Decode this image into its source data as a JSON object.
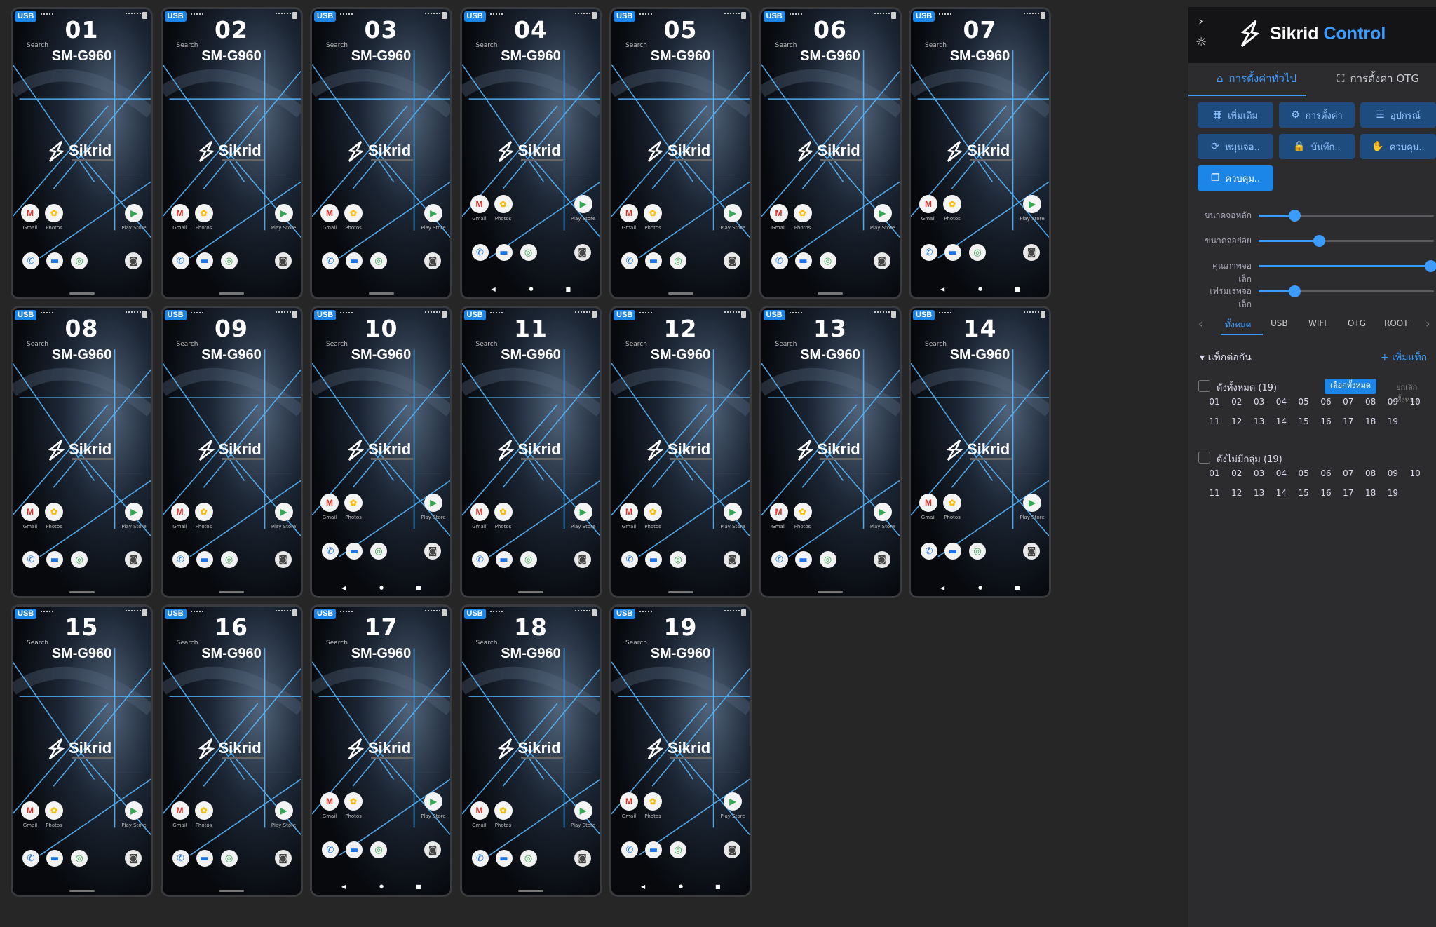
{
  "phones": [
    {
      "num": "01",
      "model": "SM-G960",
      "usb": "USB",
      "search": "Search",
      "navbar": false
    },
    {
      "num": "02",
      "model": "SM-G960",
      "usb": "USB",
      "search": "Search",
      "navbar": false
    },
    {
      "num": "03",
      "model": "SM-G960",
      "usb": "USB",
      "search": "Search",
      "navbar": false
    },
    {
      "num": "04",
      "model": "SM-G960",
      "usb": "USB",
      "search": "Search",
      "navbar": true
    },
    {
      "num": "05",
      "model": "SM-G960",
      "usb": "USB",
      "search": "Search",
      "navbar": false
    },
    {
      "num": "06",
      "model": "SM-G960",
      "usb": "USB",
      "search": "Search",
      "navbar": false
    },
    {
      "num": "07",
      "model": "SM-G960",
      "usb": "USB",
      "search": "Search",
      "navbar": true
    },
    {
      "num": "08",
      "model": "SM-G960",
      "usb": "USB",
      "search": "Search",
      "navbar": false
    },
    {
      "num": "09",
      "model": "SM-G960",
      "usb": "USB",
      "search": "Search",
      "navbar": false
    },
    {
      "num": "10",
      "model": "SM-G960",
      "usb": "USB",
      "search": "Search",
      "navbar": true
    },
    {
      "num": "11",
      "model": "SM-G960",
      "usb": "USB",
      "search": "Search",
      "navbar": false
    },
    {
      "num": "12",
      "model": "SM-G960",
      "usb": "USB",
      "search": "Search",
      "navbar": false
    },
    {
      "num": "13",
      "model": "SM-G960",
      "usb": "USB",
      "search": "Search",
      "navbar": false
    },
    {
      "num": "14",
      "model": "SM-G960",
      "usb": "USB",
      "search": "Search",
      "navbar": true
    },
    {
      "num": "15",
      "model": "SM-G960",
      "usb": "USB",
      "search": "Search",
      "navbar": false
    },
    {
      "num": "16",
      "model": "SM-G960",
      "usb": "USB",
      "search": "Search",
      "navbar": false
    },
    {
      "num": "17",
      "model": "SM-G960",
      "usb": "USB",
      "search": "Search",
      "navbar": true
    },
    {
      "num": "18",
      "model": "SM-G960",
      "usb": "USB",
      "search": "Search",
      "navbar": false
    },
    {
      "num": "19",
      "model": "SM-G960",
      "usb": "USB",
      "search": "Search",
      "navbar": true
    }
  ],
  "phone_screen": {
    "logo_text": "Sikrid",
    "apps": [
      {
        "icon": "gmail-icon",
        "glyph": "M",
        "label": "Gmail",
        "color": "#d93025"
      },
      {
        "icon": "photos-icon",
        "glyph": "✿",
        "label": "Photos",
        "color": "#fbbc04"
      },
      {
        "icon": "play-store-icon",
        "glyph": "▶",
        "label": "Play Store",
        "color": "#34a853"
      }
    ],
    "dock": [
      {
        "icon": "phone-icon",
        "glyph": "✆",
        "color": "#1a73e8"
      },
      {
        "icon": "messages-icon",
        "glyph": "▬",
        "color": "#1a73e8"
      },
      {
        "icon": "chrome-icon",
        "glyph": "◎",
        "color": "#34a853"
      },
      {
        "icon": "camera-icon",
        "glyph": "◙",
        "color": "#444"
      }
    ],
    "nav_glyphs": [
      "◀",
      "●",
      "■"
    ]
  },
  "panel": {
    "brand": {
      "part1": "Sikrid",
      "part2": "Control"
    },
    "tabs": [
      {
        "label": "การตั้งค่าทั่วไป",
        "icon": "home-icon",
        "active": true
      },
      {
        "label": "การตั้งค่า OTG",
        "icon": "expand-icon",
        "active": false
      }
    ],
    "buttons": [
      {
        "label": "เพิ่มเติม",
        "icon": "grid-icon",
        "glyph": "▦",
        "primary": false
      },
      {
        "label": "การตั้งค่า",
        "icon": "gear-icon",
        "glyph": "⚙",
        "primary": false
      },
      {
        "label": "อุปกรณ์",
        "icon": "list-icon",
        "glyph": "☰",
        "primary": false
      },
      {
        "label": "หมุนจอ..",
        "icon": "rotate-icon",
        "glyph": "⟳",
        "primary": false
      },
      {
        "label": "บันทึก..",
        "icon": "lock-icon",
        "glyph": "🔒",
        "primary": false
      },
      {
        "label": "ควบคุม..",
        "icon": "hand-icon",
        "glyph": "✋",
        "primary": false
      },
      {
        "label": "ควบคุม..",
        "icon": "copy-icon",
        "glyph": "❐",
        "primary": true
      }
    ],
    "sliders": [
      {
        "label": "ขนาดจอหลัก",
        "value": 0.21
      },
      {
        "label": "ขนาดจอย่อย",
        "value": 0.35
      },
      {
        "label": "คุณภาพจอเล็ก",
        "value": 1.0
      },
      {
        "label": "เฟรมเรทจอเล็ก",
        "value": 0.21
      }
    ],
    "filter_tabs": [
      {
        "label": "ทั้งหมด",
        "active": true
      },
      {
        "label": "USB",
        "active": false
      },
      {
        "label": "WIFI",
        "active": false
      },
      {
        "label": "OTG",
        "active": false
      },
      {
        "label": "ROOT",
        "active": false
      }
    ],
    "section": {
      "title": "แท็กต่อกัน",
      "add_label": "+ เพิ่มแท็ก"
    },
    "groups": [
      {
        "label": "ดังทั้งหมด (19)",
        "badge": "เลือกทั้งหมด",
        "link": "ยกเลิกทั้งหมด",
        "numbers": [
          "01",
          "02",
          "03",
          "04",
          "05",
          "06",
          "07",
          "08",
          "09",
          "10",
          "11",
          "12",
          "13",
          "14",
          "15",
          "16",
          "17",
          "18",
          "19"
        ]
      },
      {
        "label": "ดังไม่มีกลุ่ม (19)",
        "badge": "",
        "link": "",
        "numbers": [
          "01",
          "02",
          "03",
          "04",
          "05",
          "06",
          "07",
          "08",
          "09",
          "10",
          "11",
          "12",
          "13",
          "14",
          "15",
          "16",
          "17",
          "18",
          "19"
        ]
      }
    ]
  }
}
